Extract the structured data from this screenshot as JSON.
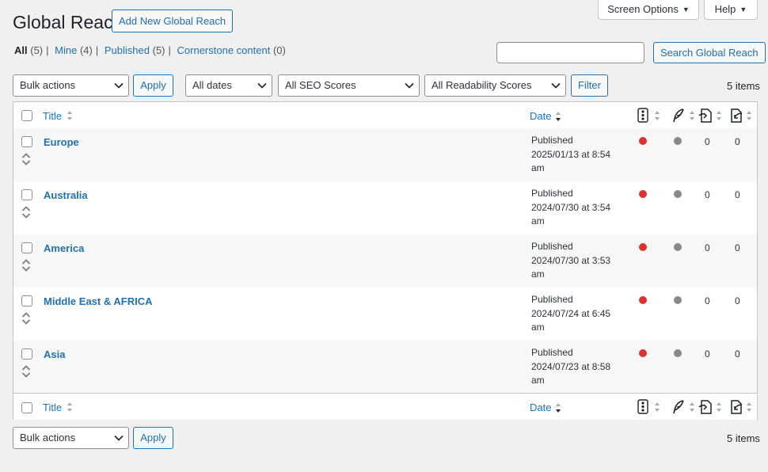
{
  "header": {
    "title": "Global Reach",
    "add_new_label": "Add New Global Reach",
    "screen_options_label": "Screen Options",
    "help_label": "Help"
  },
  "views": [
    {
      "label": "All",
      "count": "(5)"
    },
    {
      "label": "Mine",
      "count": "(4)"
    },
    {
      "label": "Published",
      "count": "(5)"
    },
    {
      "label": "Cornerstone content",
      "count": "(0)"
    }
  ],
  "search": {
    "placeholder": "",
    "button_label": "Search Global Reach"
  },
  "filters": {
    "bulk_actions": "Bulk actions",
    "apply_label": "Apply",
    "dates": "All dates",
    "seo_scores": "All SEO Scores",
    "readability_scores": "All Readability Scores",
    "filter_label": "Filter",
    "items_count": "5 items"
  },
  "columns": {
    "title": "Title",
    "date": "Date"
  },
  "rows": [
    {
      "title": "Europe",
      "status": "Published",
      "date_line": "2025/01/13 at 8:54",
      "time_suffix": "am",
      "links": "0",
      "linked": "0"
    },
    {
      "title": "Australia",
      "status": "Published",
      "date_line": "2024/07/30 at 3:54",
      "time_suffix": "am",
      "links": "0",
      "linked": "0"
    },
    {
      "title": "America",
      "status": "Published",
      "date_line": "2024/07/30 at 3:53",
      "time_suffix": "am",
      "links": "0",
      "linked": "0"
    },
    {
      "title": "Middle East & AFRICA",
      "status": "Published",
      "date_line": "2024/07/24 at 6:45",
      "time_suffix": "am",
      "links": "0",
      "linked": "0"
    },
    {
      "title": "Asia",
      "status": "Published",
      "date_line": "2024/07/23 at 8:58",
      "time_suffix": "am",
      "links": "0",
      "linked": "0"
    }
  ],
  "colors": {
    "seo_bad": "#dc3232",
    "readability_na": "#888888",
    "link": "#2271b1"
  }
}
